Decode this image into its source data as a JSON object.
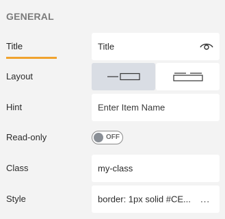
{
  "section": {
    "title": "GENERAL"
  },
  "properties": {
    "title": {
      "label": "Title",
      "value": "Title",
      "visibility_icon": "eye-icon"
    },
    "layout": {
      "label": "Layout",
      "options": [
        {
          "name": "horizontal-layout",
          "selected": true
        },
        {
          "name": "stacked-layout",
          "selected": false
        }
      ]
    },
    "hint": {
      "label": "Hint",
      "value": "Enter Item Name"
    },
    "readonly": {
      "label": "Read-only",
      "toggle_text": "OFF",
      "enabled": false
    },
    "class": {
      "label": "Class",
      "value": "my-class"
    },
    "style": {
      "label": "Style",
      "value": "border: 1px solid #CE...",
      "more_label": "..."
    }
  },
  "colors": {
    "accent": "#f0a22e",
    "background": "#f3f3f3",
    "selected_button": "#d9dde4",
    "field": "#ffffff"
  }
}
